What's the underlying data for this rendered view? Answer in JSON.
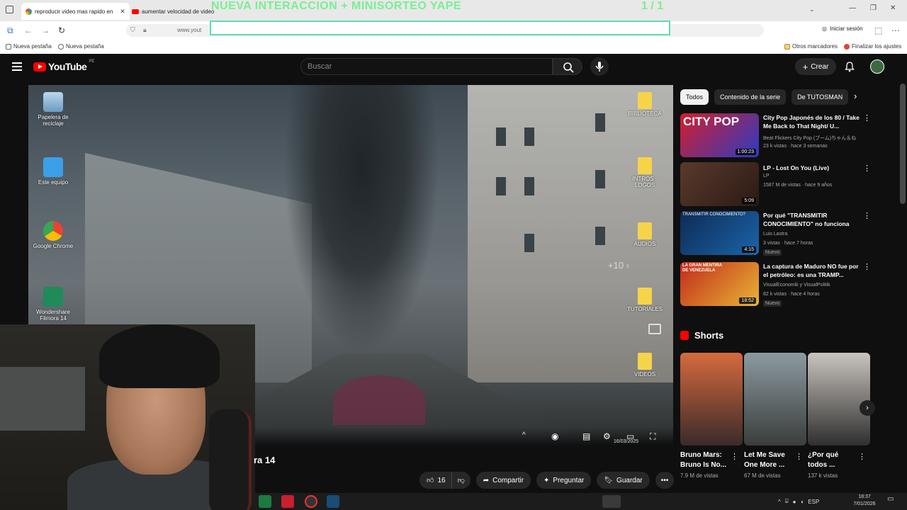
{
  "browser": {
    "tabs": [
      {
        "label": "reproducir video mas rapido en",
        "icon": "google-icon"
      },
      {
        "label": "aumentar velocidad de video",
        "icon": "youtube-icon"
      },
      {
        "label": "...",
        "icon": "youtube-icon"
      }
    ],
    "url": "www.yout",
    "signin_label": "Iniciar sesión",
    "bookmarks": [
      "Nueva pestaña",
      "Nueva pestaña"
    ],
    "other_bookmarks": "Otros marcadores",
    "finish_setup": "Finalizar los ajustes"
  },
  "overlay": {
    "title": "NUEVA INTERACCION + MINISORTEO YAPE",
    "counter": "1  / 1"
  },
  "youtube": {
    "logo_text": "YouTube",
    "country": "PE",
    "search_placeholder": "Buscar",
    "create_label": "Crear",
    "accent": "#ff0000"
  },
  "player": {
    "desktop_icons": [
      "Papelera de reciclaje",
      "Este equipo",
      "Google Chrome",
      "Wondershare Filmora 14"
    ],
    "folders": [
      "BIBLIOTECA",
      "INTROS - LOGOS",
      "AUDIOS",
      "TUTORIALES",
      "VIDEOS"
    ],
    "skip_label": "+10",
    "date_shown": "16/03/2025",
    "lang_shown": "ESP"
  },
  "video": {
    "title_fragment": "ra 14",
    "likes": "16",
    "share_label": "Compartir",
    "ask_label": "Preguntar",
    "save_label": "Guardar"
  },
  "chips": [
    "Todos",
    "Contenido de la serie",
    "De TUTOSMAN"
  ],
  "recommendations": [
    {
      "title": "City Pop Japonés de los 80 / Take Me Back to That Night/ U...",
      "channel": "Beat Flickers City Pop (ブーム)ちゃん＆ね",
      "meta": "23 k vistas · hace 3 semanas",
      "duration": "1:00:23",
      "thumb_text": "CITY POP",
      "badge": ""
    },
    {
      "title": "LP - Lost On You (Live)",
      "channel": "LP",
      "meta": "1587 M de vistas · hace 9 años",
      "duration": "5:09",
      "thumb_text": "",
      "badge": ""
    },
    {
      "title": "Por qué \"TRANSMITIR CONOCIMIENTO\" no funciona",
      "channel": "Luis Lastra",
      "meta": "3 vistas · hace 7 horas",
      "duration": "4:15",
      "thumb_text": "TRANSMITIR CONOCIMIENTO?",
      "badge": "Nuevo"
    },
    {
      "title": "La captura de Maduro NO fue por el petróleo: es una TRAMP...",
      "channel": "VisualEconomik y VisualPolitik",
      "meta": "82 k vistas · hace 4 horas",
      "duration": "18:52",
      "thumb_text": "LA GRAN MENTIRA DE VENEZUELA",
      "badge": "Nuevo"
    }
  ],
  "shorts": {
    "heading": "Shorts",
    "items": [
      {
        "title": "Bruno Mars: Bruno Is No...",
        "views": "7.9 M de vistas"
      },
      {
        "title": "Let Me Save One More ...",
        "views": "67 M de vistas"
      },
      {
        "title": "¿Por qué todos ...",
        "views": "137 k vistas"
      }
    ]
  },
  "taskbar": {
    "lang": "ESP",
    "time": "18:37",
    "date": "7/01/2026"
  }
}
